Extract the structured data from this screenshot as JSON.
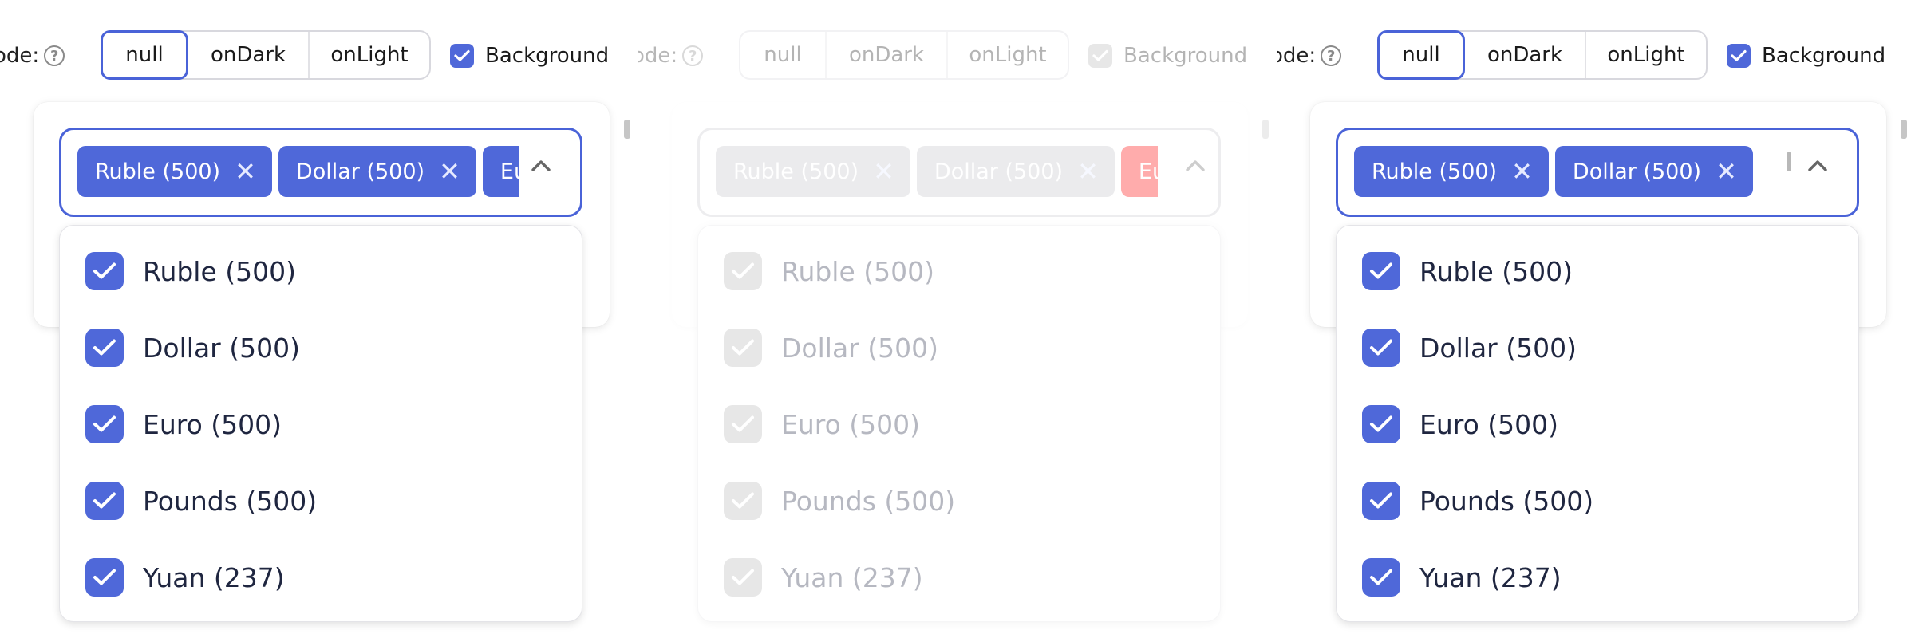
{
  "colors": {
    "accent": "#4f68d9",
    "accent_border": "#4a63d8",
    "highlight": "#ff0000"
  },
  "panels": [
    {
      "mode_label": "ode:",
      "mode_options": [
        "null",
        "onDark",
        "onLight"
      ],
      "mode_selected": "null",
      "background_label": "Background",
      "background_checked": true,
      "tags": [
        "Ruble (500)",
        "Dollar (500)",
        "Euro"
      ],
      "options": [
        "Ruble (500)",
        "Dollar (500)",
        "Euro (500)",
        "Pounds (500)",
        "Yuan (237)"
      ],
      "options_checked": [
        true,
        true,
        true,
        true,
        true
      ]
    },
    {
      "mode_label": "ode:",
      "mode_options": [
        "null",
        "onDark",
        "onLight"
      ],
      "mode_selected": "null",
      "background_label": "Background",
      "background_checked": true,
      "disabled": true,
      "tags": [
        "Ruble (500)",
        "Dollar (500)",
        "Euro"
      ],
      "options": [
        "Ruble (500)",
        "Dollar (500)",
        "Euro (500)",
        "Pounds (500)",
        "Yuan (237)"
      ],
      "options_checked": [
        true,
        true,
        true,
        true,
        true
      ]
    },
    {
      "mode_label": "ode:",
      "mode_options": [
        "null",
        "onDark",
        "onLight"
      ],
      "mode_selected": "null",
      "background_label": "Background",
      "background_checked": true,
      "tags": [
        "Ruble (500)",
        "Dollar (500)"
      ],
      "options": [
        "Ruble (500)",
        "Dollar (500)",
        "Euro (500)",
        "Pounds (500)",
        "Yuan (237)"
      ],
      "options_checked": [
        true,
        true,
        true,
        true,
        true
      ]
    }
  ]
}
